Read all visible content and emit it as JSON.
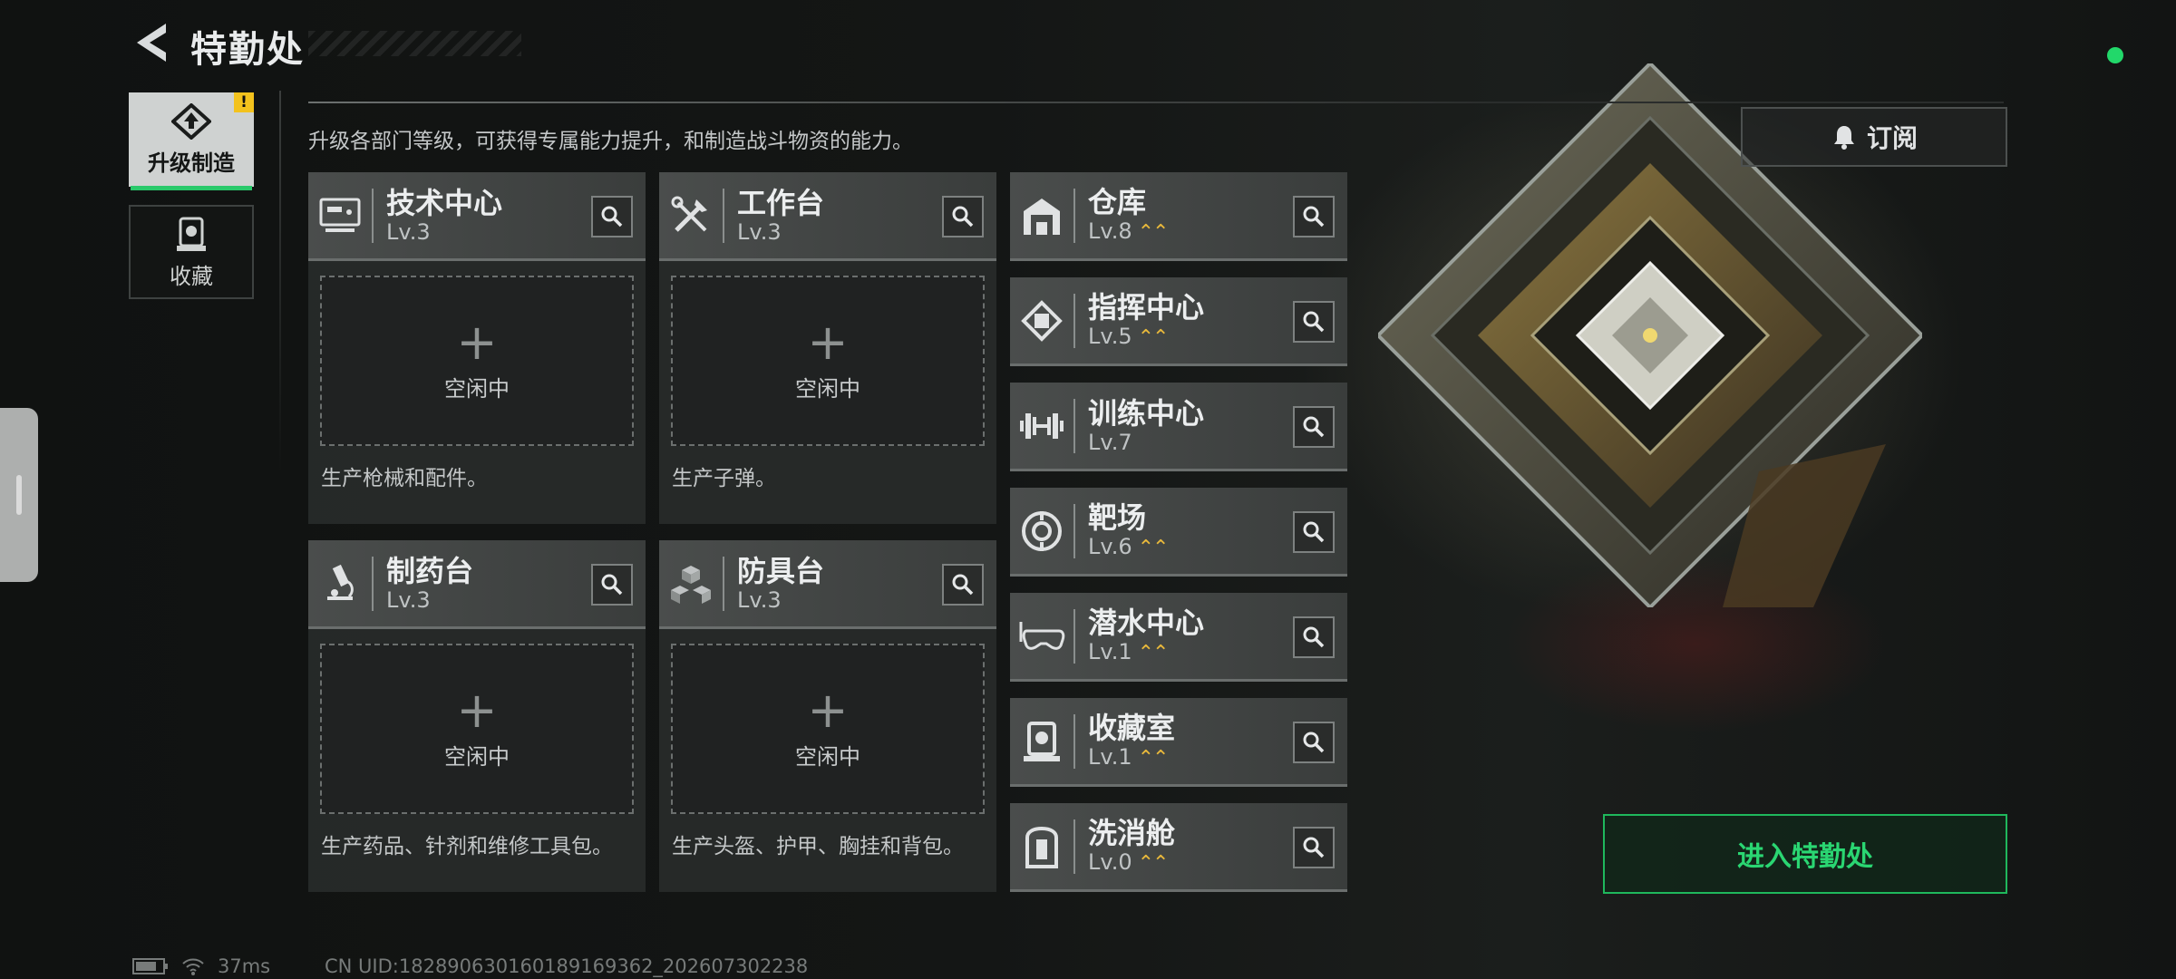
{
  "header": {
    "title": "特勤处",
    "back_icon": "back-arrow-icon"
  },
  "tabs": [
    {
      "label": "升级制造",
      "active": true,
      "icon": "upgrade-icon",
      "badge": "!"
    },
    {
      "label": "收藏",
      "active": false,
      "icon": "collection-icon"
    }
  ],
  "description": "升级各部门等级，可获得专属能力提升，和制造战斗物资的能力。",
  "subscribe": {
    "label": "订阅",
    "icon": "bell-icon"
  },
  "workshops": [
    {
      "name": "技术中心",
      "level": "Lv.3",
      "icon": "tech-center-icon",
      "slot_status": "空闲中",
      "desc": "生产枪械和配件。"
    },
    {
      "name": "工作台",
      "level": "Lv.3",
      "icon": "tools-icon",
      "slot_status": "空闲中",
      "desc": "生产子弹。"
    },
    {
      "name": "制药台",
      "level": "Lv.3",
      "icon": "microscope-icon",
      "slot_status": "空闲中",
      "desc": "生产药品、针剂和维修工具包。"
    },
    {
      "name": "防具台",
      "level": "Lv.3",
      "icon": "armor-blocks-icon",
      "slot_status": "空闲中",
      "desc": "生产头盔、护甲、胸挂和背包。"
    }
  ],
  "facilities": [
    {
      "name": "仓库",
      "level": "Lv.8",
      "upgradable": true,
      "icon": "warehouse-icon"
    },
    {
      "name": "指挥中心",
      "level": "Lv.5",
      "upgradable": true,
      "icon": "command-chip-icon"
    },
    {
      "name": "训练中心",
      "level": "Lv.7",
      "upgradable": false,
      "icon": "dumbbell-icon"
    },
    {
      "name": "靶场",
      "level": "Lv.6",
      "upgradable": true,
      "icon": "target-icon"
    },
    {
      "name": "潜水中心",
      "level": "Lv.1",
      "upgradable": true,
      "icon": "diving-mask-icon"
    },
    {
      "name": "收藏室",
      "level": "Lv.1",
      "upgradable": true,
      "icon": "collection-room-icon"
    },
    {
      "name": "洗消舱",
      "level": "Lv.0",
      "upgradable": true,
      "icon": "decon-chamber-icon"
    }
  ],
  "enter_button": {
    "label": "进入特勤处"
  },
  "footer": {
    "ping": "37ms",
    "uid": "CN UID:18289063016018916936​2_202607302238"
  },
  "colors": {
    "accent": "#29c96a",
    "warning": "#f3c21d",
    "upgrade_arrow": "#e9b93b",
    "status_online": "#22d86a"
  }
}
